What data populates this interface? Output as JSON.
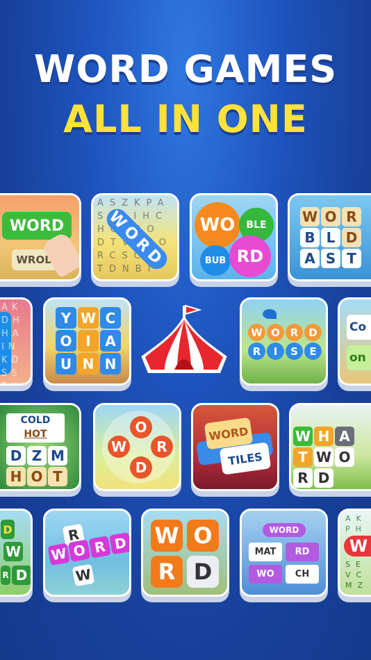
{
  "headline": {
    "line1": "WORD GAMES",
    "line2": "ALL IN ONE",
    "line1_color": "#ffffff",
    "line2_color": "#ffe23a"
  },
  "tiles": [
    {
      "name": "word-swipe",
      "main": "WORD",
      "sub": "WROD"
    },
    {
      "name": "word-search",
      "main": "WORD",
      "grid": "ASZKPASEAIHCHGLSODTVACORCSCIRTDNBI"
    },
    {
      "name": "word-bubble",
      "balls": [
        "WO",
        "BLE",
        "BUB",
        "RD"
      ]
    },
    {
      "name": "word-blast",
      "letters": [
        "W",
        "O",
        "R",
        "B",
        "L",
        "D",
        "A",
        "S",
        "T"
      ]
    },
    {
      "name": "hidden-words",
      "grid": "AKDHHAINKDSSEKIIHD",
      "highlight": [
        "H",
        "I",
        "D",
        "S",
        "E"
      ]
    },
    {
      "name": "word-stack",
      "letters": [
        "Y",
        "W",
        "C",
        "O",
        "I",
        "A",
        "U",
        "N",
        "N"
      ]
    },
    {
      "name": "circus-tent",
      "icon": "circus-tent-icon"
    },
    {
      "name": "word-rise",
      "row1": [
        "W",
        "O",
        "R",
        "D"
      ],
      "row2": [
        "R",
        "I",
        "S",
        "E"
      ]
    },
    {
      "name": "word-connect",
      "texts": [
        "Co",
        "on"
      ]
    },
    {
      "name": "cold-hot",
      "top": "COLD",
      "mid": "HOT",
      "letters": [
        "D",
        "Z",
        "M",
        "H",
        "O",
        "T"
      ]
    },
    {
      "name": "word-cross",
      "letters": [
        "O",
        "W",
        "R",
        "D"
      ]
    },
    {
      "name": "word-tiles",
      "top": "WORD",
      "bottom": "TILES"
    },
    {
      "name": "what-word",
      "row1": [
        "W",
        "H",
        "A",
        "T"
      ],
      "row2": [
        "W",
        "O",
        "R",
        "D"
      ]
    },
    {
      "name": "word-green",
      "letters": [
        "D",
        "W",
        "R",
        "D"
      ]
    },
    {
      "name": "word-crossword",
      "vertical": [
        "R",
        "W"
      ],
      "row": [
        "W",
        "O",
        "R",
        "D"
      ]
    },
    {
      "name": "word-link",
      "letters": [
        "W",
        "O",
        "R",
        "D"
      ]
    },
    {
      "name": "word-match",
      "header": "WORD",
      "chips": [
        "MAT",
        "RD",
        "WO",
        "CH"
      ]
    },
    {
      "name": "word-search-2",
      "grid": "AKPH",
      "main": "W",
      "bottom": "SEVCMZ"
    }
  ]
}
